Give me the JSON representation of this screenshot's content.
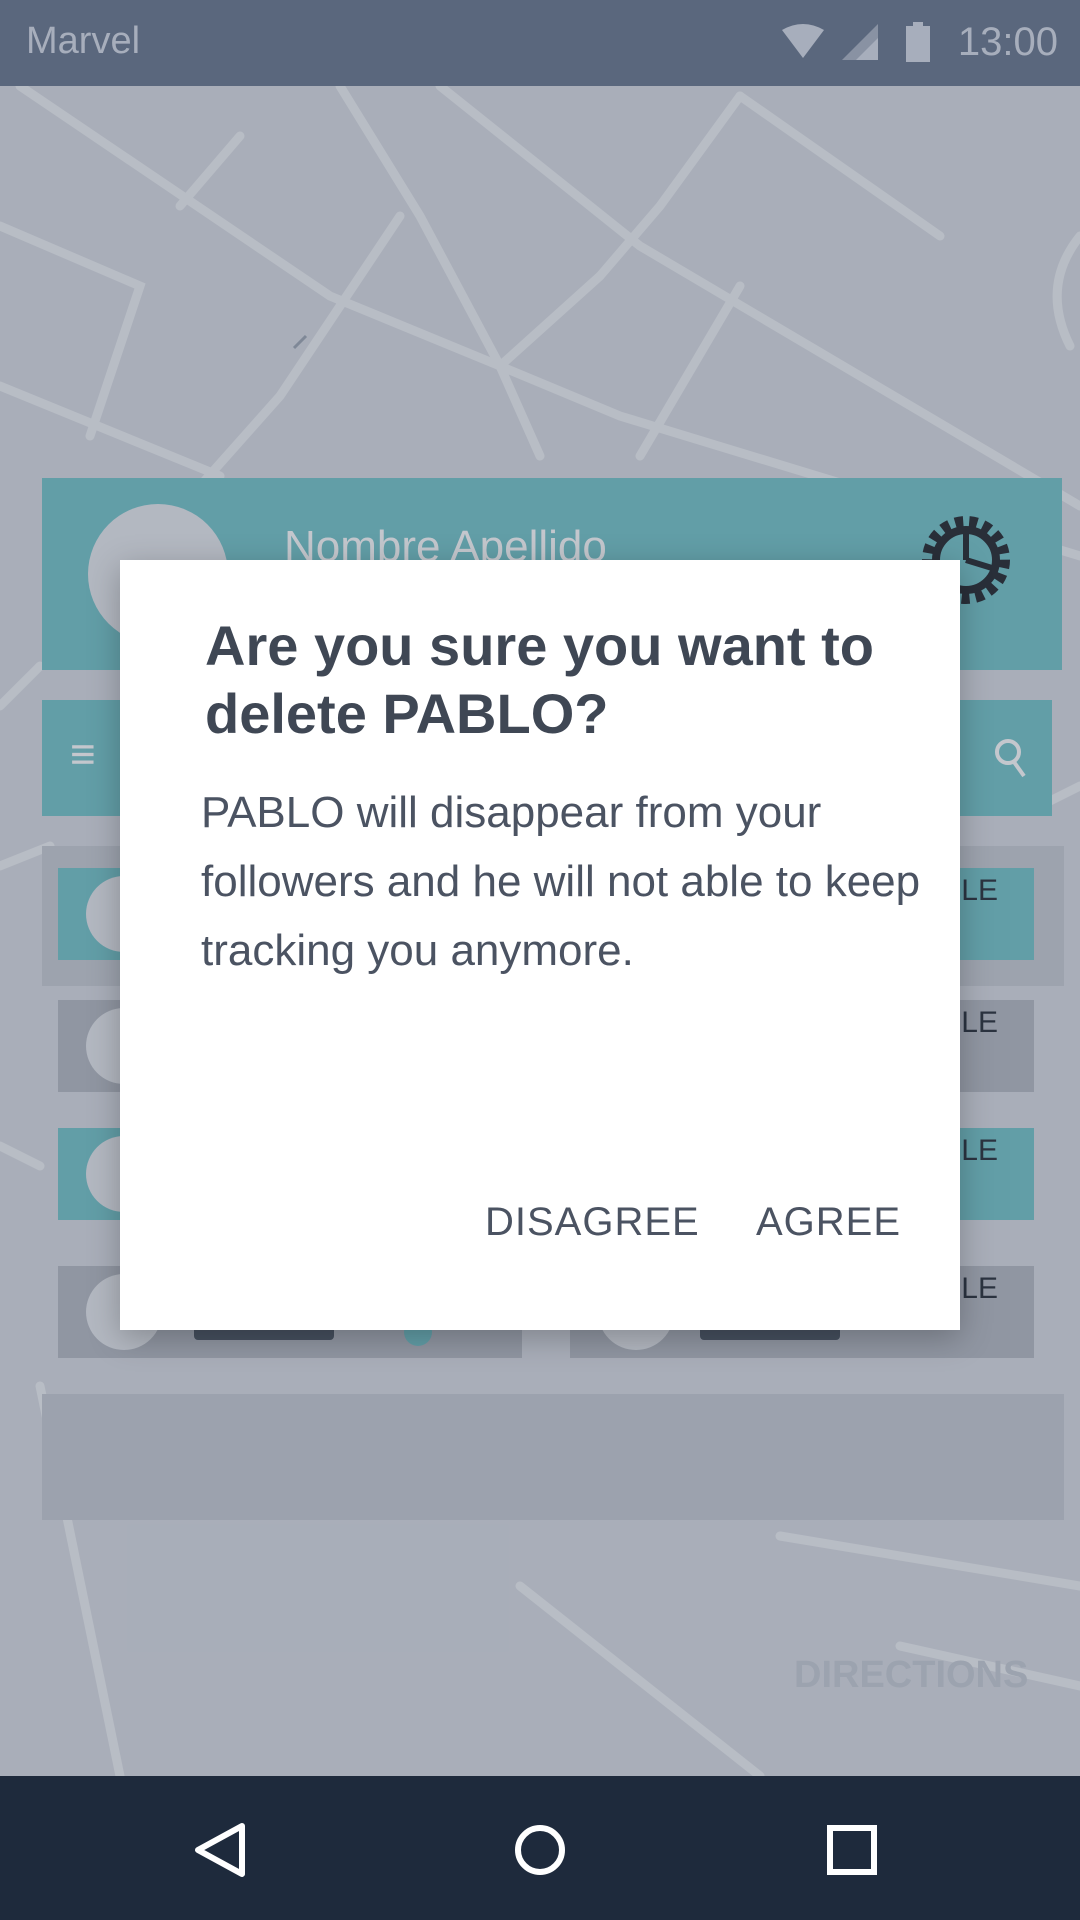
{
  "status_bar": {
    "app_name": "Marvel",
    "time": "13:00"
  },
  "background": {
    "profile_name": "Nombre Apellido",
    "directions_label": "DIRECTIONS",
    "card_label_fragment": "LE"
  },
  "dialog": {
    "title": "Are you sure you want to delete PABLO?",
    "body": "PABLO will disappear from your followers and he will not able to keep tracking you anymore.",
    "disagree_label": "DISAGREE",
    "agree_label": "AGREE"
  },
  "icons": {
    "wifi": "wifi-icon",
    "signal": "signal-icon",
    "battery": "battery-icon",
    "settings": "gear-icon",
    "menu": "menu-icon",
    "search": "search-icon",
    "back": "back-icon",
    "home": "home-icon",
    "recents": "recents-icon"
  },
  "colors": {
    "accent_teal": "#6fc3c8",
    "status_bar": "#64728a",
    "nav_bar": "#1e2a3c",
    "dialog_bg": "#ffffff"
  }
}
